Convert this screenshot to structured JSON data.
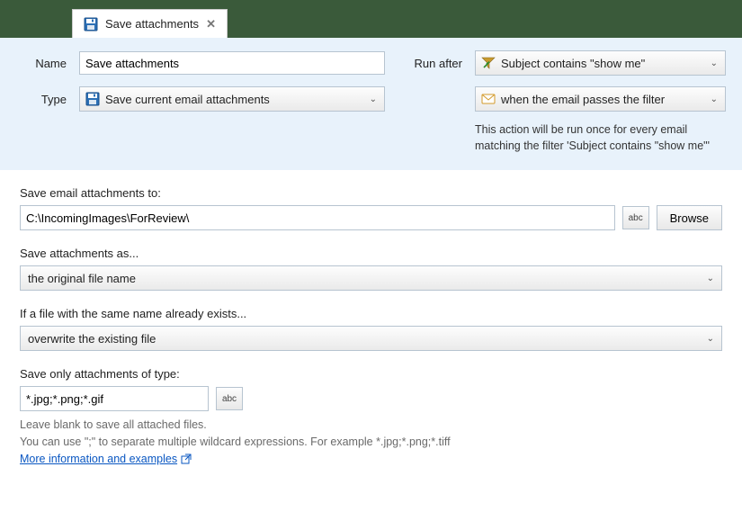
{
  "tab": {
    "title": "Save attachments"
  },
  "header": {
    "name_label": "Name",
    "name_value": "Save attachments",
    "type_label": "Type",
    "type_value": "Save current email attachments",
    "run_after_label": "Run after",
    "run_after_value": "Subject contains \"show me\"",
    "when_value": "when the email passes the filter",
    "note": "This action will be run once for every email matching the filter 'Subject contains \"show me\"'"
  },
  "save_to": {
    "label": "Save email attachments to:",
    "value": "C:\\IncomingImages\\ForReview\\",
    "abc": "abc",
    "browse": "Browse"
  },
  "save_as": {
    "label": "Save attachments as...",
    "value": "the original file name"
  },
  "exists": {
    "label": "If a file with the same name already exists...",
    "value": "overwrite the existing file"
  },
  "filter": {
    "label": "Save only attachments of type:",
    "value": "*.jpg;*.png;*.gif",
    "abc": "abc",
    "help1": "Leave blank to save all attached files.",
    "help2": "You can use \";\" to separate multiple wildcard expressions. For example *.jpg;*.png;*.tiff",
    "link": "More information and examples"
  }
}
